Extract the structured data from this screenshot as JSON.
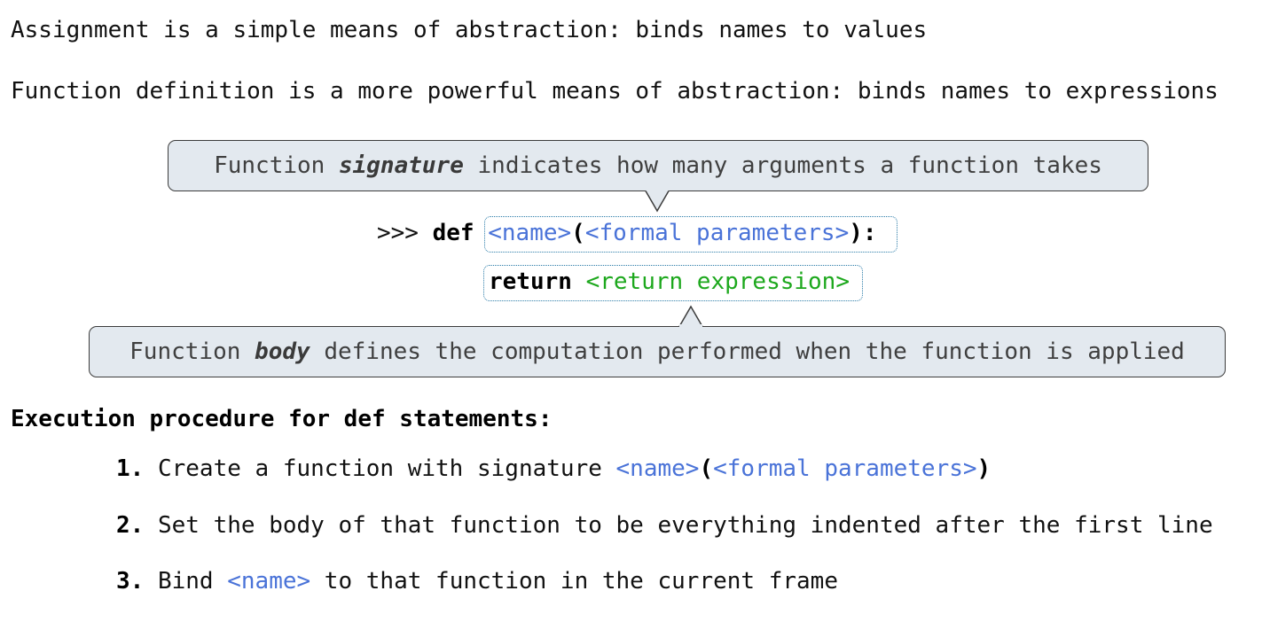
{
  "intro": {
    "line1": "Assignment is a simple means of abstraction: binds names to values",
    "line2": "Function definition is a more powerful means of abstraction: binds names to expressions"
  },
  "signature_callout": {
    "before": "Function ",
    "emphasis": "signature",
    "after": " indicates how many arguments a function takes"
  },
  "code": {
    "prompt": ">>> ",
    "def_keyword": "def",
    "name_placeholder": "<name>",
    "open_paren": "(",
    "params_placeholder": "<formal parameters>",
    "close_paren_colon": "):",
    "return_keyword": "return",
    "return_placeholder": "<return expression>"
  },
  "body_callout": {
    "before": "Function ",
    "emphasis": "body",
    "after": " defines the computation performed when the function is applied"
  },
  "execution": {
    "heading": "Execution procedure for def statements:",
    "step1": {
      "number": "1.",
      "text": " Create a function with signature ",
      "name": "<name>",
      "open_paren": "(",
      "params": "<formal parameters>",
      "close_paren": ")"
    },
    "step2": {
      "number": "2.",
      "text": " Set the body of that function to be everything indented after the first line"
    },
    "step3": {
      "number": "3.",
      "before": " Bind ",
      "name": "<name>",
      "after": " to that function in the current frame"
    }
  },
  "colors": {
    "placeholder_blue": "#4a73d8",
    "return_green": "#1da81d",
    "callout_fill": "#e3e9ef",
    "dotted_border": "#2a7ba8"
  }
}
